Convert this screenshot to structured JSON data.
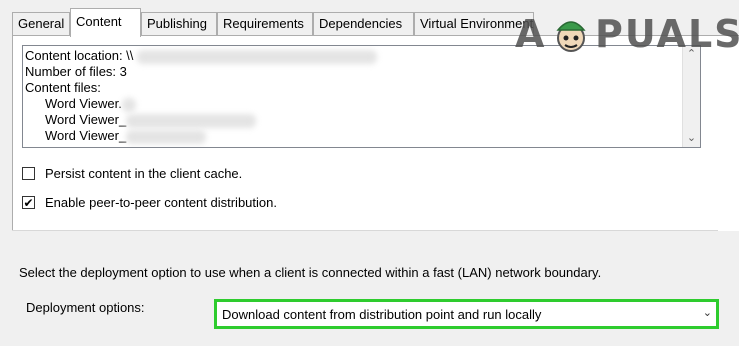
{
  "tabs": [
    {
      "label": "General"
    },
    {
      "label": "Content",
      "active": true
    },
    {
      "label": "Publishing"
    },
    {
      "label": "Requirements"
    },
    {
      "label": "Dependencies"
    },
    {
      "label": "Virtual Environment"
    }
  ],
  "content_box": {
    "location_label": "Content location: \\\\",
    "files_count_label": "Number of files: 3",
    "files_label": "Content files:",
    "files": [
      "Word Viewer.",
      "Word Viewer_",
      "Word Viewer_"
    ]
  },
  "options": {
    "persist_label": "Persist content in the client cache.",
    "persist_checked": false,
    "p2p_label": "Enable peer-to-peer content distribution.",
    "p2p_checked": true
  },
  "deployment": {
    "description": "Select the deployment option to use when a client is connected within a fast (LAN) network boundary.",
    "label": "Deployment options:",
    "selected": "Download content from distribution point and run locally"
  },
  "watermark": {
    "brand": "APPUALS",
    "left": "A",
    "right": "PUALS"
  },
  "colors": {
    "highlight": "#2ecc2e",
    "watermark_cap": "#3a9a4a"
  }
}
